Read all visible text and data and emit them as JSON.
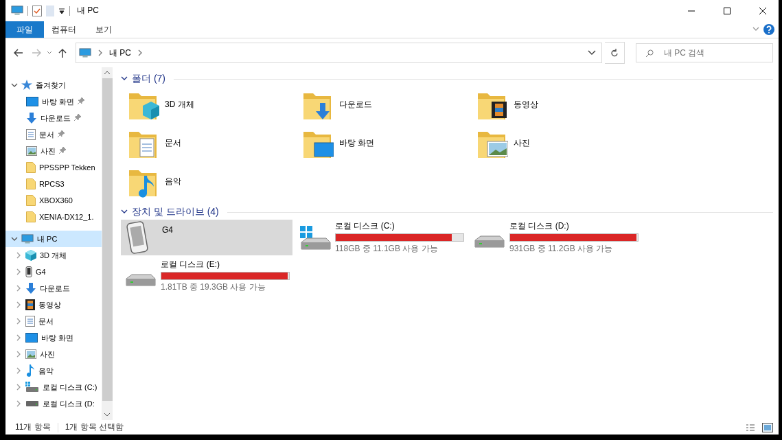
{
  "window": {
    "title": "내 PC"
  },
  "ribbon_tabs": [
    {
      "label": "파일",
      "selected": true
    },
    {
      "label": "컴퓨터",
      "selected": false
    },
    {
      "label": "보기",
      "selected": false
    }
  ],
  "address": {
    "path": [
      "내 PC"
    ]
  },
  "search": {
    "placeholder": "내 PC 검색"
  },
  "nav": [
    {
      "label": "즐겨찾기",
      "expanded": true,
      "selected": false,
      "children": [
        {
          "label": "바탕 화면",
          "pinned": true
        },
        {
          "label": "다운로드",
          "pinned": true
        },
        {
          "label": "문서",
          "pinned": true
        },
        {
          "label": "사진",
          "pinned": true
        },
        {
          "label": "PPSSPP Tekken",
          "pinned": false
        },
        {
          "label": "RPCS3",
          "pinned": false
        },
        {
          "label": "XBOX360",
          "pinned": false
        },
        {
          "label": "XENIA-DX12_1.",
          "pinned": false
        }
      ]
    },
    {
      "label": "내 PC",
      "expanded": true,
      "selected": true,
      "children": [
        {
          "label": "3D 개체",
          "expanded": false
        },
        {
          "label": "G4",
          "expanded": false
        },
        {
          "label": "다운로드",
          "expanded": false
        },
        {
          "label": "동영상",
          "expanded": false
        },
        {
          "label": "문서",
          "expanded": false
        },
        {
          "label": "바탕 화면",
          "expanded": false
        },
        {
          "label": "사진",
          "expanded": false
        },
        {
          "label": "음악",
          "expanded": false
        },
        {
          "label": "로컬 디스크 (C:)",
          "expanded": false
        },
        {
          "label": "로컬 디스크 (D:",
          "expanded": false
        }
      ]
    }
  ],
  "folders": {
    "title": "폴더 (7)",
    "expanded": true,
    "items": [
      {
        "label": "3D 개체"
      },
      {
        "label": "다운로드"
      },
      {
        "label": "동영상"
      },
      {
        "label": "문서"
      },
      {
        "label": "바탕 화면"
      },
      {
        "label": "사진"
      },
      {
        "label": "음악"
      }
    ]
  },
  "drives": {
    "title": "장치 및 드라이브 (4)",
    "expanded": true,
    "items": [
      {
        "kind": "device",
        "label": "G4",
        "selected": true
      },
      {
        "kind": "drive",
        "label": "로컬 디스크 (C:)",
        "level": 0.906,
        "free": "118GB 중 11.1GB 사용 가능",
        "selected": false,
        "system": true
      },
      {
        "kind": "drive",
        "label": "로컬 디스크 (D:)",
        "level": 0.988,
        "free": "931GB 중 11.2GB 사용 가능",
        "selected": false,
        "system": false
      },
      {
        "kind": "drive",
        "label": "로컬 디스크 (E:)",
        "level": 0.99,
        "free": "1.81TB 중 19.3GB 사용 가능",
        "selected": false,
        "system": false
      }
    ]
  },
  "status_bar": {
    "count": "11개 항목",
    "selection": "1개 항목 선택함"
  }
}
